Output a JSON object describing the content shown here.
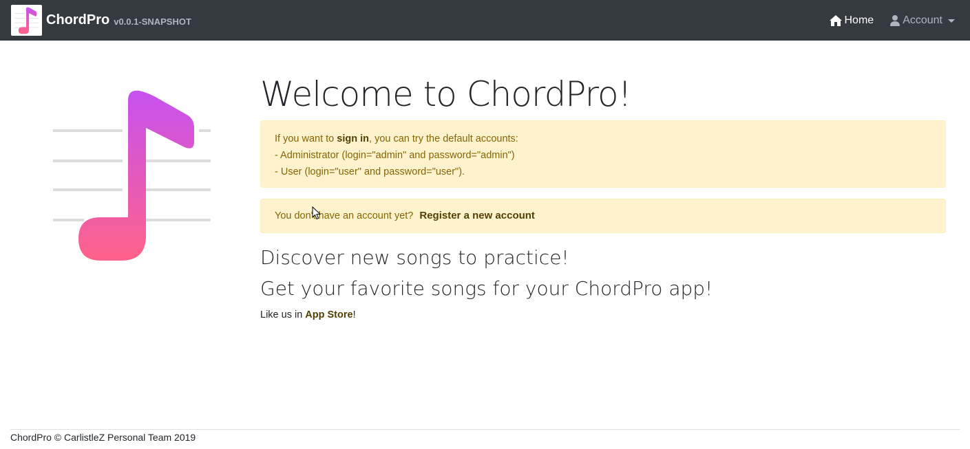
{
  "navbar": {
    "brand_title": "ChordPro",
    "brand_version": "v0.0.1-SNAPSHOT",
    "home_label": "Home",
    "account_label": "Account",
    "home_icon": "home-icon",
    "account_icon": "user-icon"
  },
  "main": {
    "title": "Welcome to ChordPro!",
    "signin_alert": {
      "prefix": "If you want to ",
      "link": "sign in",
      "suffix": ", you can try the default accounts:",
      "line2": "- Administrator (login=\"admin\" and password=\"admin\")",
      "line3": "- User (login=\"user\" and password=\"user\")."
    },
    "register_alert": {
      "text": "You don't have an account yet?",
      "link": "Register a new account"
    },
    "lead1": "Discover new songs to practice!",
    "lead2": "Get your favorite songs for your ChordPro app!",
    "likeus_prefix": "Like us in ",
    "likeus_link": "App Store",
    "likeus_suffix": "!"
  },
  "footer": {
    "text": "ChordPro © CarlistleZ Personal Team 2019"
  },
  "colors": {
    "navbar_bg": "#343a40",
    "alert_bg": "#fff3cd",
    "alert_text": "#856404",
    "logo_gradient_top": "#c651f0",
    "logo_gradient_bottom": "#ff6289"
  }
}
